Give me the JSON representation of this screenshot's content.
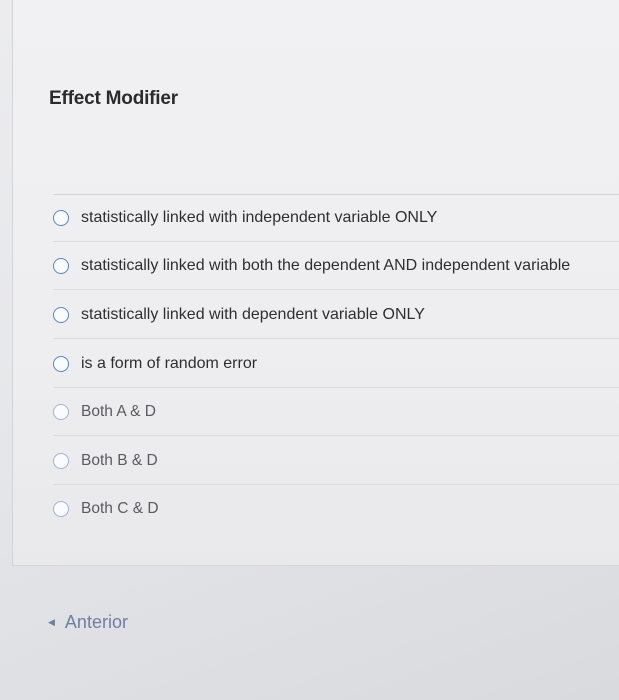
{
  "question": {
    "title": "Effect Modifier"
  },
  "options": [
    {
      "label": "statistically linked with independent variable ONLY"
    },
    {
      "label": "statistically linked with both the dependent AND independent variable"
    },
    {
      "label": "statistically linked with dependent variable ONLY"
    },
    {
      "label": "is a form of random error"
    },
    {
      "label": "Both A & D"
    },
    {
      "label": "Both B & D"
    },
    {
      "label": "Both C & D"
    }
  ],
  "navigation": {
    "previous_label": "Anterior",
    "previous_icon": "triangle-left-icon"
  },
  "colors": {
    "radio_border": "#5a83c9",
    "link": "#6f7fa0",
    "text": "#2f2f33"
  }
}
